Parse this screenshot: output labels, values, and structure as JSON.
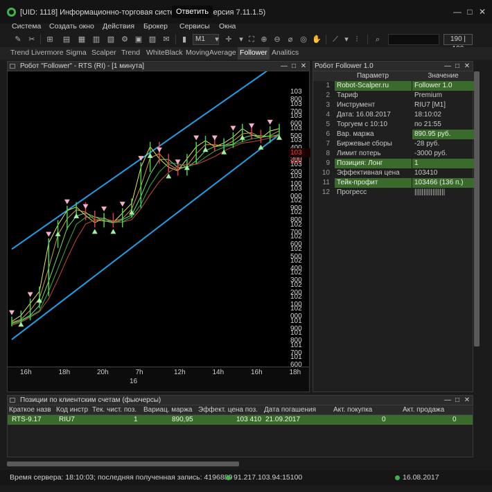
{
  "window": {
    "title": "[UID: 1118] Информационно-торговая система QUIK (версия 7.11.1.5)",
    "tooltip": "Ответить",
    "controls": [
      "—",
      "□",
      "✕"
    ]
  },
  "menu": [
    "Система",
    "Создать окно",
    "Действия",
    "Брокер",
    "Сервисы",
    "Окна"
  ],
  "toolbar": {
    "timeframe": "M1",
    "counter": "190 | 190"
  },
  "tabs": [
    {
      "label": "Trend Livermore",
      "active": false
    },
    {
      "label": "Sigma",
      "active": false
    },
    {
      "label": "Scalper",
      "active": false
    },
    {
      "label": "Trend",
      "active": false
    },
    {
      "label": "WhiteBlack",
      "active": false
    },
    {
      "label": "MovingAverage",
      "active": false
    },
    {
      "label": "Follower",
      "active": true
    },
    {
      "label": "Analitics",
      "active": false
    }
  ],
  "chart_window": {
    "title": "Робот \"Follower\" - RTS (RI) - [1 минута]",
    "current_price": "103 300"
  },
  "chart_data": {
    "type": "line",
    "y_ticks": [
      "103 800",
      "103 700",
      "103 600",
      "103 500",
      "103 400",
      "103 300",
      "103 200",
      "103 100",
      "103 000",
      "102 900",
      "102 800",
      "102 700",
      "102 600",
      "102 500",
      "102 400",
      "102 300",
      "102 200",
      "102 100",
      "102 000",
      "101 900",
      "101 800",
      "101 700",
      "101 600"
    ],
    "x_ticks": [
      "16h",
      "18h",
      "20h",
      "7h",
      "12h",
      "14h",
      "16h",
      "18h"
    ],
    "x_subticks": [
      "16"
    ],
    "ylim": [
      101560,
      103860
    ],
    "close": [
      101900,
      101950,
      102050,
      102150,
      102550,
      102700,
      102820,
      102850,
      102780,
      102720,
      102760,
      102720,
      102800,
      102880,
      103180,
      103350,
      103250,
      103180,
      103150,
      103250,
      103350,
      103400,
      103350,
      103380,
      103430,
      103500,
      103450,
      103420,
      103480,
      103500
    ],
    "channel_upper": [
      [
        0,
        102500
      ],
      [
        29,
        104050
      ]
    ],
    "channel_lower": [
      [
        0,
        101750
      ],
      [
        29,
        103450
      ]
    ],
    "colors": {
      "channel": "#1ea0e6",
      "price_tag": "#ff3b3b"
    }
  },
  "robot_panel": {
    "title": "Робот Follower 1.0",
    "header_param": "Параметр",
    "header_value": "Значение",
    "rows": [
      {
        "n": "1",
        "param": "Robot-Scalper.ru",
        "value": "Follower 1.0",
        "green": true
      },
      {
        "n": "2",
        "param": "Тариф",
        "value": "Premium",
        "green": false
      },
      {
        "n": "3",
        "param": "Инструмент",
        "value": "RIU7  [M1]",
        "green": false
      },
      {
        "n": "4",
        "param": "Дата: 16.08.2017",
        "value": "18:10:02",
        "green": false
      },
      {
        "n": "5",
        "param": "Торгуем с 10:10",
        "value": "по 21:55",
        "green": false
      },
      {
        "n": "6",
        "param": "Вар. маржа",
        "value": "890.95 руб.",
        "green": false,
        "value_green": true
      },
      {
        "n": "7",
        "param": "Биржевые сборы",
        "value": "-28 руб.",
        "green": false
      },
      {
        "n": "8",
        "param": "Лимит потерь",
        "value": "-3000 руб.",
        "green": false
      },
      {
        "n": "9",
        "param": "Позиция: Лонг",
        "value": "1",
        "green": true
      },
      {
        "n": "10",
        "param": "Эффективная цена",
        "value": "103410",
        "green": false
      },
      {
        "n": "11",
        "param": "Тейк-профит",
        "value": "103466 (136 п.)",
        "green": true
      },
      {
        "n": "12",
        "param": "Прогресс",
        "value": "|||||||||||||||||",
        "green": false
      }
    ]
  },
  "positions": {
    "title": "Позиции по клиентским счетам (фьючерсы)",
    "headers": [
      "Краткое назв",
      "Код инстр",
      "Тек. чист. поз.",
      "Вариац. маржа",
      "Эффект. цена поз.",
      "Дата погашения",
      "Акт. покупка",
      "Акт. продажа"
    ],
    "row": [
      "RTS-9.17",
      "RIU7",
      "1",
      "890,95",
      "103 410",
      "21.09.2017",
      "0",
      "0"
    ]
  },
  "status": {
    "server_time": "Время сервера: 18:10:03; последняя полученная запись: 4196889",
    "ip": "91.217.103.94:15100",
    "date": "16.08.2017"
  }
}
